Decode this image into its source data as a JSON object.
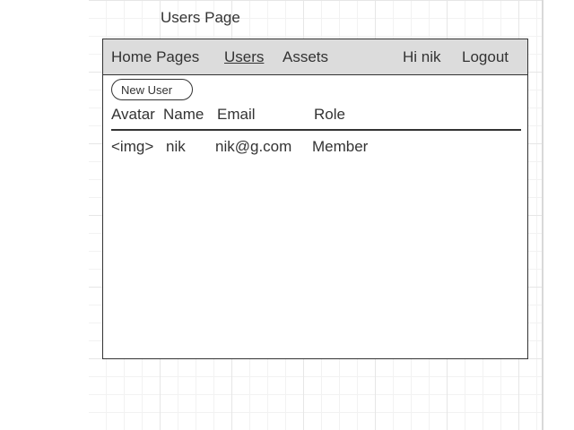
{
  "page": {
    "title": "Users Page"
  },
  "nav": {
    "home": "Home Pages",
    "users": "Users",
    "assets": "Assets",
    "greeting": "Hi nik",
    "logout": "Logout"
  },
  "toolbar": {
    "new_user_label": "New User"
  },
  "table": {
    "columns": [
      "Avatar",
      "Name",
      "Email",
      "Role"
    ],
    "rows": [
      {
        "avatar": "<img>",
        "name": "nik",
        "email": "nik@g.com",
        "role": "Member"
      }
    ]
  },
  "colors": {
    "navbar_bg": "#dcdcdc",
    "border": "#333333",
    "text": "#333333"
  }
}
